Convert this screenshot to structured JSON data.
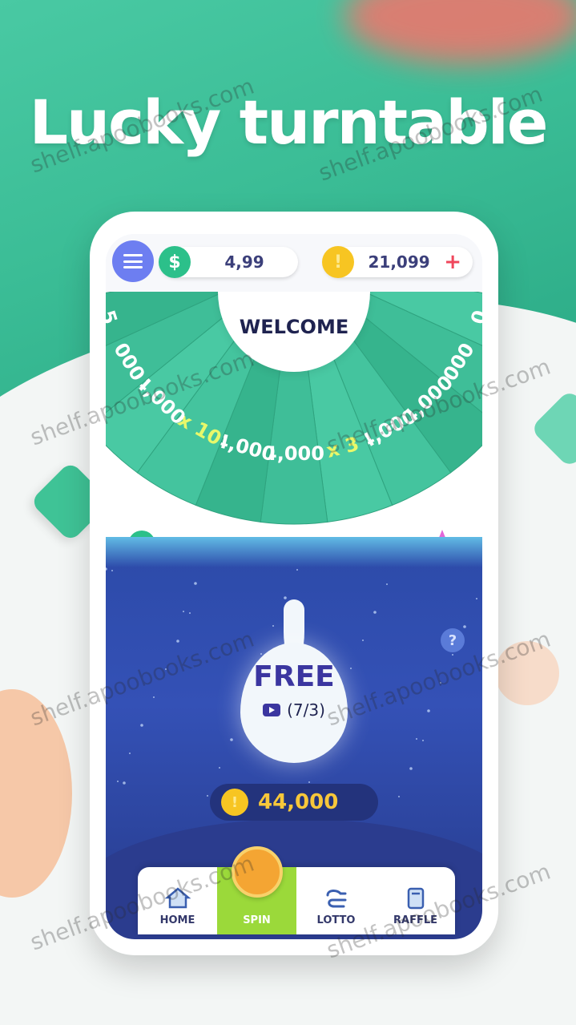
{
  "headline": "Lucky turntable",
  "topbar": {
    "cash_value": "4,99",
    "coin_value": "21,099",
    "cash_icon_glyph": "$",
    "plus_glyph": "+"
  },
  "wheel": {
    "welcome": "WELCOME",
    "segments": [
      "0",
      "000",
      "4,000",
      "4,000",
      "x 3",
      "4,000",
      "4,000",
      "x 10",
      "4,000",
      "000",
      "5"
    ]
  },
  "free_button": {
    "label": "FREE",
    "count": "(7/3)"
  },
  "help_glyph": "?",
  "total_coins": "44,000",
  "nav": {
    "items": [
      {
        "label": "HOME"
      },
      {
        "label": "SPIN"
      },
      {
        "label": "LOTTO"
      },
      {
        "label": "RAFFLE"
      }
    ],
    "active_index": 1
  },
  "watermark": "shelf.apoobooks.com",
  "colors": {
    "brand_green": "#3bbd96",
    "accent_blue": "#6d7ef1",
    "coin_gold": "#f7c522",
    "nav_active": "#9bd93a",
    "night_blue": "#2c4aa8"
  }
}
